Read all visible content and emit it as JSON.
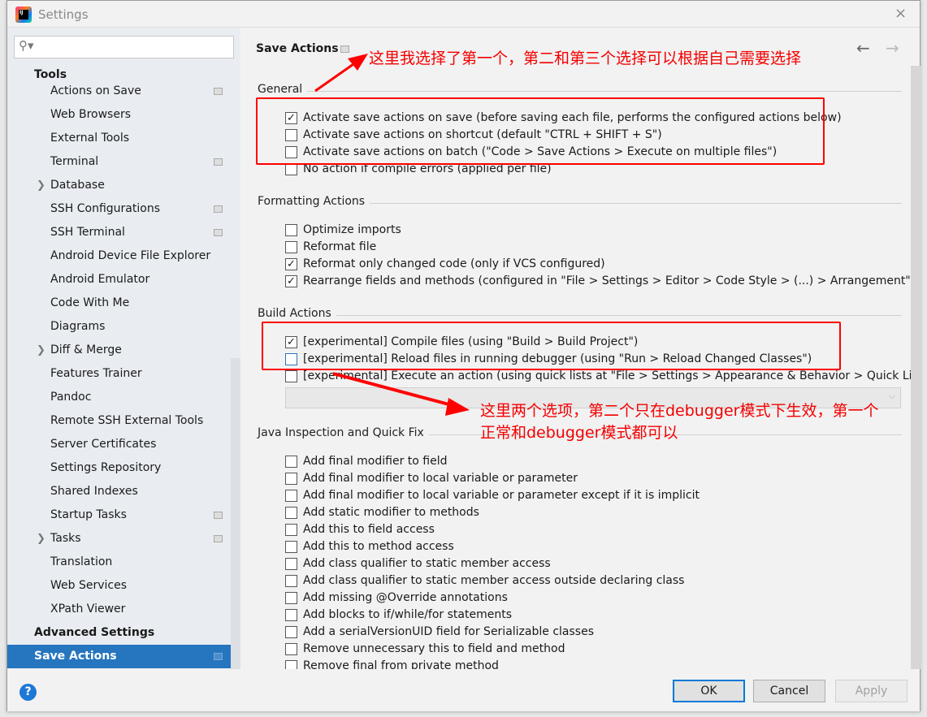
{
  "window": {
    "title": "Settings",
    "close": "×"
  },
  "sidebar": {
    "search_icon": "⚲▾",
    "section_tools": "Tools",
    "items": [
      {
        "label": "Actions on Save",
        "page_icon": true
      },
      {
        "label": "Web Browsers"
      },
      {
        "label": "External Tools"
      },
      {
        "label": "Terminal",
        "page_icon": true
      },
      {
        "label": "Database",
        "expandable": true
      },
      {
        "label": "SSH Configurations",
        "page_icon": true
      },
      {
        "label": "SSH Terminal",
        "page_icon": true
      },
      {
        "label": "Android Device File Explorer"
      },
      {
        "label": "Android Emulator"
      },
      {
        "label": "Code With Me"
      },
      {
        "label": "Diagrams"
      },
      {
        "label": "Diff & Merge",
        "expandable": true
      },
      {
        "label": "Features Trainer"
      },
      {
        "label": "Pandoc"
      },
      {
        "label": "Remote SSH External Tools"
      },
      {
        "label": "Server Certificates"
      },
      {
        "label": "Settings Repository"
      },
      {
        "label": "Shared Indexes"
      },
      {
        "label": "Startup Tasks",
        "page_icon": true
      },
      {
        "label": "Tasks",
        "expandable": true,
        "page_icon": true
      },
      {
        "label": "Translation"
      },
      {
        "label": "Web Services"
      },
      {
        "label": "XPath Viewer"
      }
    ],
    "advanced": "Advanced Settings",
    "selected": "Save Actions"
  },
  "content": {
    "title": "Save Actions",
    "back": "←",
    "forward": "→",
    "sections": [
      {
        "title": "General",
        "items": [
          {
            "label": "Activate save actions on save (before saving each file, performs the configured actions below)",
            "checked": true
          },
          {
            "label": "Activate save actions on shortcut (default \"CTRL + SHIFT + S\")",
            "checked": false
          },
          {
            "label": "Activate save actions on batch (\"Code > Save Actions > Execute on multiple files\")",
            "checked": false
          },
          {
            "label": "No action if compile errors (applied per file)",
            "checked": false
          }
        ]
      },
      {
        "title": "Formatting Actions",
        "items": [
          {
            "label": "Optimize imports",
            "checked": false
          },
          {
            "label": "Reformat file",
            "checked": false
          },
          {
            "label": "Reformat only changed code (only if VCS configured)",
            "checked": true
          },
          {
            "label": "Rearrange fields and methods (configured in \"File > Settings > Editor > Code Style > (...) > Arrangement\")",
            "checked": true
          }
        ]
      },
      {
        "title": "Build Actions",
        "items": [
          {
            "label": "[experimental] Compile files (using \"Build > Build Project\")",
            "checked": true
          },
          {
            "label": "[experimental] Reload files in running debugger (using \"Run > Reload Changed Classes\")",
            "checked": false,
            "focused": true
          },
          {
            "label": "[experimental] Execute an action (using quick lists at \"File > Settings > Appearance & Behavior > Quick Lists\")",
            "checked": false
          }
        ]
      },
      {
        "title": "Java Inspection and Quick Fix",
        "items": [
          {
            "label": "Add final modifier to field",
            "checked": false
          },
          {
            "label": "Add final modifier to local variable or parameter",
            "checked": false
          },
          {
            "label": "Add final modifier to local variable or parameter except if it is implicit",
            "checked": false
          },
          {
            "label": "Add static modifier to methods",
            "checked": false
          },
          {
            "label": "Add this to field access",
            "checked": false
          },
          {
            "label": "Add this to method access",
            "checked": false
          },
          {
            "label": "Add class qualifier to static member access",
            "checked": false
          },
          {
            "label": "Add class qualifier to static member access outside declaring class",
            "checked": false
          },
          {
            "label": "Add missing @Override annotations",
            "checked": false
          },
          {
            "label": "Add blocks to if/while/for statements",
            "checked": false
          },
          {
            "label": "Add a serialVersionUID field for Serializable classes",
            "checked": false
          },
          {
            "label": "Remove unnecessary this to field and method",
            "checked": false
          },
          {
            "label": "Remove final from private method",
            "checked": false
          }
        ]
      }
    ],
    "combo_arrow": "⌵"
  },
  "footer": {
    "help": "?",
    "ok": "OK",
    "cancel": "Cancel",
    "apply": "Apply"
  },
  "annotations": {
    "top": "这里我选择了第一个，第二和第三个选择可以根据自己需要选择",
    "bottom_line1": "这里两个选项，第二个只在debugger模式下生效，第一个",
    "bottom_line2": "正常和debugger模式都可以",
    "color": "#f40000"
  }
}
